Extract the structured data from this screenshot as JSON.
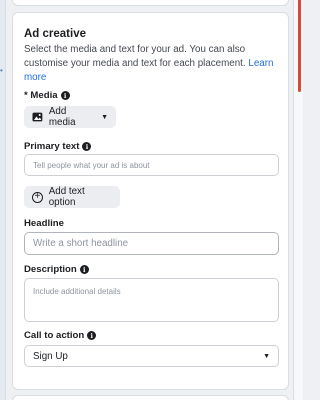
{
  "card": {
    "title": "Ad creative",
    "description": "Select the media and text for your ad. You can also customise your media and text for each placement.",
    "learn_more": "Learn more"
  },
  "media": {
    "label": "* Media",
    "button_label": "Add media"
  },
  "primary_text": {
    "label": "Primary text",
    "placeholder": "Tell people what your ad is about",
    "add_option_label": "Add text option"
  },
  "headline": {
    "label": "Headline",
    "placeholder": "Write a short headline"
  },
  "description_field": {
    "label": "Description",
    "placeholder": "Include additional details"
  },
  "cta": {
    "label": "Call to action",
    "selected": "Sign Up"
  },
  "colors": {
    "link": "#216fdb",
    "accent_right": "#e0453a"
  }
}
